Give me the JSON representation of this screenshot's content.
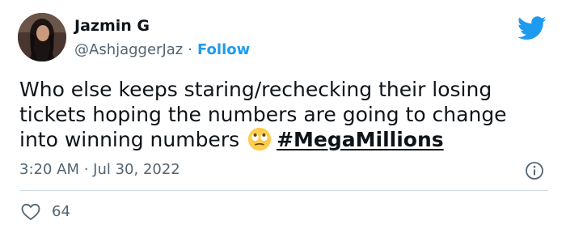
{
  "author": {
    "name": "Jazmin G",
    "handle": "@AshjaggerJaz",
    "separator": "·",
    "follow_label": "Follow"
  },
  "tweet": {
    "line1": "Who else keeps staring/rechecking their losing",
    "line2": "tickets hoping the numbers are going to change",
    "line3": "into winning numbers",
    "emoji": "face-with-rolling-eyes-emoji",
    "hashtag": "#MegaMillions"
  },
  "meta": {
    "timestamp": "3:20 AM · Jul 30, 2022"
  },
  "engagement": {
    "likes": "64"
  },
  "colors": {
    "twitter_blue": "#1d9bf0",
    "text": "#0f1419",
    "muted": "#536471",
    "divider": "#cfd9de"
  },
  "icons": {
    "brand": "twitter-bird-icon",
    "info": "info-icon",
    "like": "heart-icon"
  }
}
